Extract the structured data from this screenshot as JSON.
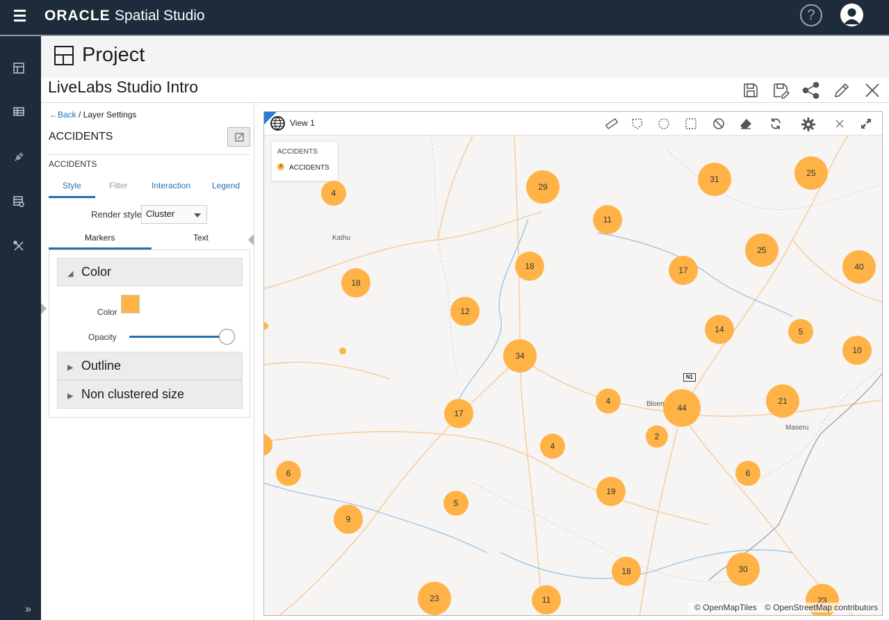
{
  "app": {
    "brand_main": "ORACLE",
    "brand_sub": "Spatial Studio",
    "help_glyph": "?"
  },
  "sidenav": {
    "items": [
      {
        "name": "dashboard-icon"
      },
      {
        "name": "table-icon"
      },
      {
        "name": "plug-icon"
      },
      {
        "name": "dataset-icon"
      },
      {
        "name": "tools-icon"
      }
    ],
    "expand_glyph": "»"
  },
  "project": {
    "header": "Project",
    "name": "LiveLabs Studio Intro"
  },
  "panel": {
    "back_label": "←Back",
    "crumb_sep": " / ",
    "crumb_current": "Layer Settings",
    "layer_title": "ACCIDENTS",
    "layer_subtitle": "ACCIDENTS",
    "tabs": [
      "Style",
      "Filter",
      "Interaction",
      "Legend"
    ],
    "render_style_label": "Render style",
    "render_style_value": "Cluster",
    "subtabs": [
      "Markers",
      "Text"
    ],
    "sections": {
      "color_title": "Color",
      "color_label": "Color",
      "color_value": "#ffb347",
      "opacity_label": "Opacity",
      "opacity_value": 1.0,
      "outline_title": "Outline",
      "non_clustered_title": "Non clustered size"
    }
  },
  "map": {
    "view_label": "View 1",
    "legend_title": "ACCIDENTS",
    "legend_item": "ACCIDENTS",
    "legend_badge": "4",
    "labels": [
      "Kathu",
      "Bloem",
      "Maseru"
    ],
    "route_shield": "N1",
    "attribution": [
      "© OpenMapTiles",
      "© OpenStreetMap contributors"
    ],
    "clusters": [
      "4",
      "29",
      "31",
      "25",
      "11",
      "25",
      "18",
      "17",
      "40",
      "18",
      "12",
      "14",
      "5",
      "34",
      "10",
      "4",
      "44",
      "21",
      "17",
      "2",
      "4",
      "6",
      "6",
      "19",
      "5",
      "9",
      "18",
      "30",
      "23",
      "11",
      "23"
    ]
  }
}
